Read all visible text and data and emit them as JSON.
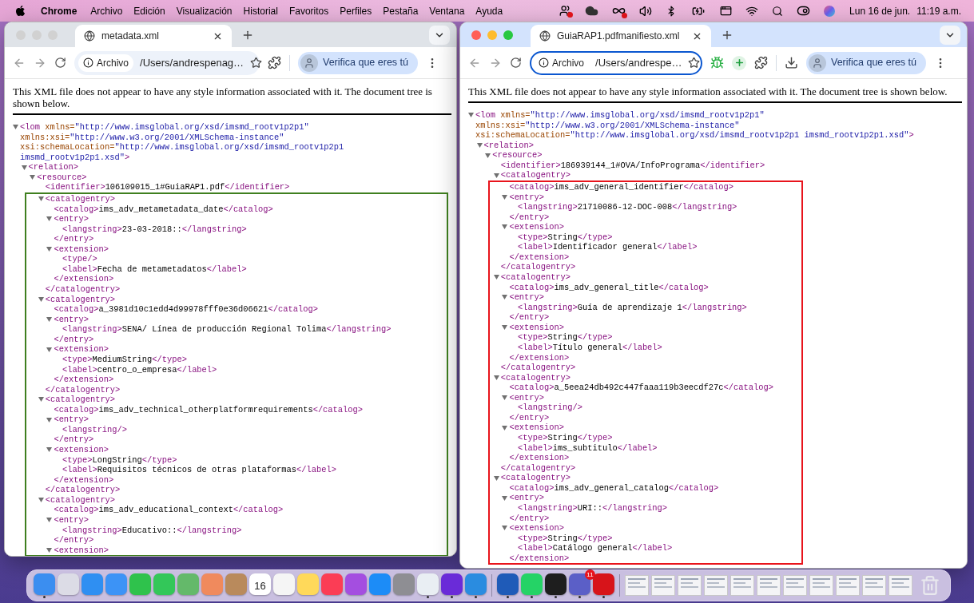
{
  "menu_bar": {
    "app": "Chrome",
    "items": [
      "Archivo",
      "Edición",
      "Visualización",
      "Historial",
      "Favoritos",
      "Perfiles",
      "Pestaña",
      "Ventana",
      "Ayuda"
    ],
    "date": "Lun 16 de jun.",
    "time": "11:19 a.m."
  },
  "windows": [
    {
      "active": false,
      "tabs": [
        {
          "title": "metadata.xml",
          "selected": true
        }
      ],
      "security_chip": "Archivo",
      "url": "/Users/andrespenag…",
      "omnibox_focused": false,
      "toolbar_icons": [
        {
          "kind": "puzzle"
        }
      ],
      "profile_label": "Verifica que eres tú",
      "document": {
        "notice": "This XML file does not appear to have any style information associated with it. The document tree is shown below.",
        "frame": {
          "color": "#3f7f1f"
        },
        "nodes": [
          {
            "kind": "element",
            "expanded": true,
            "open_lines": [
              [
                {
                  "kind": "tag",
                  "text": "<lom"
                },
                {
                  "kind": "attr",
                  "text": " xmlns="
                },
                {
                  "kind": "value",
                  "text": "\"http://www.imsglobal.org/xsd/imsmd_rootv1p2p1\""
                }
              ],
              [
                {
                  "kind": "attr",
                  "text": "xmlns:xsi="
                },
                {
                  "kind": "value",
                  "text": "\"http://www.w3.org/2001/XMLSchema-instance\""
                }
              ],
              [
                {
                  "kind": "attr",
                  "text": "xsi:schemaLocation="
                },
                {
                  "kind": "value",
                  "text": "\"http://www.imsglobal.org/xsd/imsmd_rootv1p2p1"
                }
              ],
              [
                {
                  "kind": "value",
                  "text": "imsmd_rootv1p2p1.xsd\""
                },
                {
                  "kind": "tag",
                  "text": ">"
                }
              ]
            ],
            "children": [
              {
                "kind": "element",
                "open": "<relation>",
                "expanded": true,
                "children": [
                  {
                    "kind": "element",
                    "open": "<resource>",
                    "expanded": true,
                    "children": [
                      {
                        "kind": "leaf",
                        "open": "<identifier>",
                        "text": "106109015_1#GuiaRAP1.pdf",
                        "close": "</identifier>"
                      },
                      {
                        "kind": "element",
                        "open": "<catalogentry>",
                        "expanded": true,
                        "frame_start": true,
                        "children": [
                          {
                            "kind": "leaf",
                            "open": "<catalog>",
                            "text": "ims_adv_metametadata_date",
                            "close": "</catalog>"
                          },
                          {
                            "kind": "element",
                            "open": "<entry>",
                            "expanded": true,
                            "children": [
                              {
                                "kind": "leaf",
                                "open": "<langstring>",
                                "text": "23-03-2018::",
                                "close": "</langstring>"
                              }
                            ],
                            "close": "</entry>"
                          },
                          {
                            "kind": "element",
                            "open": "<extension>",
                            "expanded": true,
                            "children": [
                              {
                                "kind": "leaf",
                                "open": "<type/>"
                              },
                              {
                                "kind": "leaf",
                                "open": "<label>",
                                "text": "Fecha de metametadatos",
                                "close": "</label>"
                              }
                            ],
                            "close": "</extension>"
                          }
                        ],
                        "close": "</catalogentry>"
                      },
                      {
                        "kind": "element",
                        "open": "<catalogentry>",
                        "expanded": true,
                        "children": [
                          {
                            "kind": "leaf",
                            "open": "<catalog>",
                            "text": "a_3981d10c1edd4d99978fff0e36d06621",
                            "close": "</catalog>"
                          },
                          {
                            "kind": "element",
                            "open": "<entry>",
                            "expanded": true,
                            "children": [
                              {
                                "kind": "leaf",
                                "open": "<langstring>",
                                "text": "SENA/ Línea de producción Regional Tolima",
                                "close": "</langstring>"
                              }
                            ],
                            "close": "</entry>"
                          },
                          {
                            "kind": "element",
                            "open": "<extension>",
                            "expanded": true,
                            "children": [
                              {
                                "kind": "leaf",
                                "open": "<type>",
                                "text": "MediumString",
                                "close": "</type>"
                              },
                              {
                                "kind": "leaf",
                                "open": "<label>",
                                "text": "centro_o_empresa",
                                "close": "</label>"
                              }
                            ],
                            "close": "</extension>"
                          }
                        ],
                        "close": "</catalogentry>"
                      },
                      {
                        "kind": "element",
                        "open": "<catalogentry>",
                        "expanded": true,
                        "children": [
                          {
                            "kind": "leaf",
                            "open": "<catalog>",
                            "text": "ims_adv_technical_otherplatformrequirements",
                            "close": "</catalog>"
                          },
                          {
                            "kind": "element",
                            "open": "<entry>",
                            "expanded": true,
                            "children": [
                              {
                                "kind": "leaf",
                                "open": "<langstring/>"
                              }
                            ],
                            "close": "</entry>"
                          },
                          {
                            "kind": "element",
                            "open": "<extension>",
                            "expanded": true,
                            "children": [
                              {
                                "kind": "leaf",
                                "open": "<type>",
                                "text": "LongString",
                                "close": "</type>"
                              },
                              {
                                "kind": "leaf",
                                "open": "<label>",
                                "text": "Requisitos técnicos de otras plataformas",
                                "close": "</label>"
                              }
                            ],
                            "close": "</extension>"
                          }
                        ],
                        "close": "</catalogentry>"
                      },
                      {
                        "kind": "element",
                        "open": "<catalogentry>",
                        "expanded": true,
                        "children": [
                          {
                            "kind": "leaf",
                            "open": "<catalog>",
                            "text": "ims_adv_educational_context",
                            "close": "</catalog>"
                          },
                          {
                            "kind": "element",
                            "open": "<entry>",
                            "expanded": true,
                            "children": [
                              {
                                "kind": "leaf",
                                "open": "<langstring>",
                                "text": "Educativo::",
                                "close": "</langstring>"
                              }
                            ],
                            "close": "</entry>"
                          },
                          {
                            "kind": "element",
                            "open": "<extension>",
                            "expanded": true
                          }
                        ]
                      }
                    ]
                  }
                ]
              }
            ]
          }
        ]
      }
    },
    {
      "active": true,
      "tabs": [
        {
          "title": "GuiaRAP1.pdfmanifiesto.xml",
          "selected": true
        }
      ],
      "security_chip": "Archivo",
      "url": "/Users/andrespe…",
      "omnibox_focused": true,
      "toolbar_icons": [
        {
          "kind": "bug"
        },
        {
          "kind": "add"
        },
        {
          "kind": "puzzle"
        },
        {
          "kind": "download"
        }
      ],
      "profile_label": "Verifica que eres tú",
      "document": {
        "notice": "This XML file does not appear to have any style information associated with it. The document tree is shown below.",
        "frame": {
          "color": "#e8141c"
        },
        "nodes": [
          {
            "kind": "element",
            "expanded": true,
            "open_lines": [
              [
                {
                  "kind": "tag",
                  "text": "<lom"
                },
                {
                  "kind": "attr",
                  "text": " xmlns="
                },
                {
                  "kind": "value",
                  "text": "\"http://www.imsglobal.org/xsd/imsmd_rootv1p2p1\""
                }
              ],
              [
                {
                  "kind": "attr",
                  "text": "xmlns:xsi="
                },
                {
                  "kind": "value",
                  "text": "\"http://www.w3.org/2001/XMLSchema-instance\""
                }
              ],
              [
                {
                  "kind": "attr",
                  "text": "xsi:schemaLocation="
                },
                {
                  "kind": "value",
                  "text": "\"http://www.imsglobal.org/xsd/imsmd_rootv1p2p1 imsmd_rootv1p2p1.xsd\""
                },
                {
                  "kind": "tag",
                  "text": ">"
                }
              ]
            ],
            "children": [
              {
                "kind": "element",
                "open": "<relation>",
                "expanded": true,
                "children": [
                  {
                    "kind": "element",
                    "open": "<resource>",
                    "expanded": true,
                    "children": [
                      {
                        "kind": "leaf",
                        "open": "<identifier>",
                        "text": "186939144_1#OVA/InfoPrograma",
                        "close": "</identifier>"
                      },
                      {
                        "kind": "element",
                        "open": "<catalogentry>",
                        "expanded": true,
                        "children": [
                          {
                            "kind": "leaf",
                            "open": "<catalog>",
                            "text": "ims_adv_general_identifier",
                            "close": "</catalog>",
                            "frame_start": true
                          },
                          {
                            "kind": "element",
                            "open": "<entry>",
                            "expanded": true,
                            "children": [
                              {
                                "kind": "leaf",
                                "open": "<langstring>",
                                "text": "21710086-12-DOC-008",
                                "close": "</langstring>"
                              }
                            ],
                            "close": "</entry>"
                          },
                          {
                            "kind": "element",
                            "open": "<extension>",
                            "expanded": true,
                            "children": [
                              {
                                "kind": "leaf",
                                "open": "<type>",
                                "text": "String",
                                "close": "</type>"
                              },
                              {
                                "kind": "leaf",
                                "open": "<label>",
                                "text": "Identificador general",
                                "close": "</label>"
                              }
                            ],
                            "close": "</extension>"
                          }
                        ],
                        "close": "</catalogentry>"
                      },
                      {
                        "kind": "element",
                        "open": "<catalogentry>",
                        "expanded": true,
                        "children": [
                          {
                            "kind": "leaf",
                            "open": "<catalog>",
                            "text": "ims_adv_general_title",
                            "close": "</catalog>"
                          },
                          {
                            "kind": "element",
                            "open": "<entry>",
                            "expanded": true,
                            "children": [
                              {
                                "kind": "leaf",
                                "open": "<langstring>",
                                "text": "Guía de aprendizaje 1",
                                "close": "</langstring>"
                              }
                            ],
                            "close": "</entry>"
                          },
                          {
                            "kind": "element",
                            "open": "<extension>",
                            "expanded": true,
                            "children": [
                              {
                                "kind": "leaf",
                                "open": "<type>",
                                "text": "String",
                                "close": "</type>"
                              },
                              {
                                "kind": "leaf",
                                "open": "<label>",
                                "text": "Título general",
                                "close": "</label>"
                              }
                            ],
                            "close": "</extension>"
                          }
                        ],
                        "close": "</catalogentry>"
                      },
                      {
                        "kind": "element",
                        "open": "<catalogentry>",
                        "expanded": true,
                        "children": [
                          {
                            "kind": "leaf",
                            "open": "<catalog>",
                            "text": "a_5eea24db492c447faaa119b3eecdf27c",
                            "close": "</catalog>"
                          },
                          {
                            "kind": "element",
                            "open": "<entry>",
                            "expanded": true,
                            "children": [
                              {
                                "kind": "leaf",
                                "open": "<langstring/>"
                              }
                            ],
                            "close": "</entry>"
                          },
                          {
                            "kind": "element",
                            "open": "<extension>",
                            "expanded": true,
                            "children": [
                              {
                                "kind": "leaf",
                                "open": "<type>",
                                "text": "String",
                                "close": "</type>"
                              },
                              {
                                "kind": "leaf",
                                "open": "<label>",
                                "text": "ims_subtitulo",
                                "close": "</label>"
                              }
                            ],
                            "close": "</extension>"
                          }
                        ],
                        "close": "</catalogentry>"
                      },
                      {
                        "kind": "element",
                        "open": "<catalogentry>",
                        "expanded": true,
                        "children": [
                          {
                            "kind": "leaf",
                            "open": "<catalog>",
                            "text": "ims_adv_general_catalog",
                            "close": "</catalog>"
                          },
                          {
                            "kind": "element",
                            "open": "<entry>",
                            "expanded": true,
                            "children": [
                              {
                                "kind": "leaf",
                                "open": "<langstring>",
                                "text": "URI::",
                                "close": "</langstring>"
                              }
                            ],
                            "close": "</entry>"
                          },
                          {
                            "kind": "element",
                            "open": "<extension>",
                            "expanded": true,
                            "children": [
                              {
                                "kind": "leaf",
                                "open": "<type>",
                                "text": "String",
                                "close": "</type>"
                              },
                              {
                                "kind": "leaf",
                                "open": "<label>",
                                "text": "Catálogo general",
                                "close": "</label>"
                              }
                            ],
                            "close": "</extension>"
                          }
                        ]
                      }
                    ]
                  }
                ]
              }
            ]
          }
        ]
      }
    }
  ],
  "dock": {
    "items": [
      {
        "kind": "app",
        "color": "#3b8ef0",
        "running": true
      },
      {
        "kind": "app",
        "color": "#dcdce6",
        "running": false
      },
      {
        "kind": "app",
        "color": "#2f8ff2",
        "running": false
      },
      {
        "kind": "app",
        "color": "#3c93f6",
        "running": false
      },
      {
        "kind": "app",
        "color": "#2fc24c",
        "running": false
      },
      {
        "kind": "app",
        "color": "#33c759",
        "running": false
      },
      {
        "kind": "app",
        "color": "#64b96a",
        "running": false
      },
      {
        "kind": "app",
        "color": "#f08a5d",
        "running": false
      },
      {
        "kind": "app",
        "color": "#b98a5c",
        "running": false
      },
      {
        "kind": "calendar",
        "color": "#ffffff",
        "day": "16",
        "running": false
      },
      {
        "kind": "app",
        "color": "#f5f5f5",
        "running": false
      },
      {
        "kind": "app",
        "color": "#ffd95a",
        "running": false
      },
      {
        "kind": "app",
        "color": "#fb3d55",
        "running": false
      },
      {
        "kind": "app",
        "color": "#a44ee0",
        "running": false
      },
      {
        "kind": "app",
        "color": "#1c8cf7",
        "running": false
      },
      {
        "kind": "app",
        "color": "#8e8e93",
        "running": false
      },
      {
        "kind": "app",
        "color": "#e9eef3",
        "running": true
      },
      {
        "kind": "app",
        "color": "#6a2bd8",
        "running": true
      },
      {
        "kind": "app",
        "color": "#2a8ce0",
        "running": true
      },
      {
        "kind": "separator"
      },
      {
        "kind": "app",
        "color": "#1f5bb8",
        "running": true
      },
      {
        "kind": "app",
        "color": "#25d366",
        "running": true
      },
      {
        "kind": "app",
        "color": "#1e1e1e",
        "running": true
      },
      {
        "kind": "app",
        "color": "#5b5fc7",
        "running": true,
        "badge": "11"
      },
      {
        "kind": "app",
        "color": "#d7141a",
        "running": true
      },
      {
        "kind": "separator"
      },
      {
        "kind": "thumbnail"
      },
      {
        "kind": "thumbnail"
      },
      {
        "kind": "thumbnail"
      },
      {
        "kind": "thumbnail"
      },
      {
        "kind": "thumbnail"
      },
      {
        "kind": "thumbnail"
      },
      {
        "kind": "thumbnail"
      },
      {
        "kind": "thumbnail"
      },
      {
        "kind": "thumbnail"
      },
      {
        "kind": "thumbnail"
      },
      {
        "kind": "thumbnail"
      },
      {
        "kind": "trash"
      }
    ]
  }
}
